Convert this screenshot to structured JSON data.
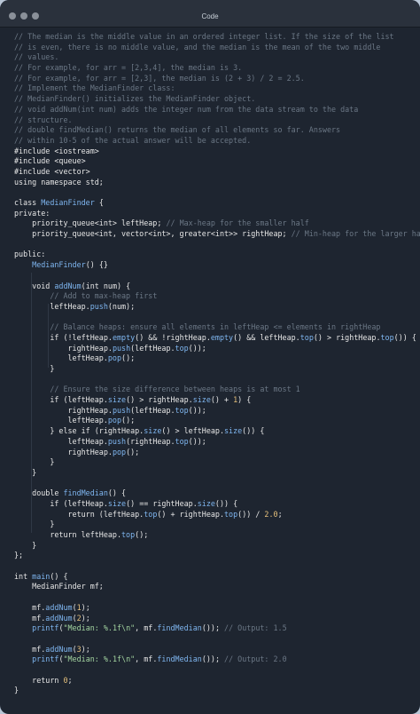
{
  "window": {
    "title": "Code"
  },
  "code_lines": [
    [
      [
        "c",
        "// The median is the middle value in an ordered integer list. If the size of the list"
      ]
    ],
    [
      [
        "c",
        "// is even, there is no middle value, and the median is the mean of the two middle"
      ]
    ],
    [
      [
        "c",
        "// values."
      ]
    ],
    [
      [
        "c",
        "// For example, for arr = [2,3,4], the median is 3."
      ]
    ],
    [
      [
        "c",
        "// For example, for arr = [2,3], the median is (2 + 3) / 2 = 2.5."
      ]
    ],
    [
      [
        "c",
        "// Implement the MedianFinder class:"
      ]
    ],
    [
      [
        "c",
        "// MedianFinder() initializes the MedianFinder object."
      ]
    ],
    [
      [
        "c",
        "// void addNum(int num) adds the integer num from the data stream to the data"
      ]
    ],
    [
      [
        "c",
        "// structure."
      ]
    ],
    [
      [
        "c",
        "// double findMedian() returns the median of all elements so far. Answers"
      ]
    ],
    [
      [
        "c",
        "// within 10-5 of the actual answer will be accepted."
      ]
    ],
    [
      [
        "t",
        "#include <iostream>"
      ]
    ],
    [
      [
        "t",
        "#include <queue>"
      ]
    ],
    [
      [
        "t",
        "#include <vector>"
      ]
    ],
    [
      [
        "t",
        "using namespace std;"
      ]
    ],
    [
      [
        "t",
        ""
      ]
    ],
    [
      [
        "t",
        "class "
      ],
      [
        "f",
        "MedianFinder"
      ],
      [
        "t",
        " {"
      ]
    ],
    [
      [
        "t",
        "private:"
      ]
    ],
    [
      [
        "t",
        "    priority_queue<int> leftHeap; "
      ],
      [
        "c",
        "// Max-heap for the smaller half"
      ]
    ],
    [
      [
        "t",
        "    priority_queue<int, vector<int>, greater<int>> rightHeap; "
      ],
      [
        "c",
        "// Min-heap for the larger half"
      ]
    ],
    [
      [
        "t",
        ""
      ]
    ],
    [
      [
        "t",
        "public:"
      ]
    ],
    [
      [
        "t",
        "    "
      ],
      [
        "f",
        "MedianFinder"
      ],
      [
        "t",
        "() {}"
      ]
    ],
    [
      [
        "t",
        ""
      ]
    ],
    [
      [
        "t",
        "    void "
      ],
      [
        "f",
        "addNum"
      ],
      [
        "t",
        "(int num) {"
      ]
    ],
    [
      [
        "t",
        "        "
      ],
      [
        "c",
        "// Add to max-heap first"
      ]
    ],
    [
      [
        "t",
        "        leftHeap."
      ],
      [
        "f",
        "push"
      ],
      [
        "t",
        "(num);"
      ]
    ],
    [
      [
        "t",
        ""
      ]
    ],
    [
      [
        "t",
        "        "
      ],
      [
        "c",
        "// Balance heaps: ensure all elements in leftHeap <= elements in rightHeap"
      ]
    ],
    [
      [
        "t",
        "        if (!leftHeap."
      ],
      [
        "f",
        "empty"
      ],
      [
        "t",
        "() && !rightHeap."
      ],
      [
        "f",
        "empty"
      ],
      [
        "t",
        "() && leftHeap."
      ],
      [
        "f",
        "top"
      ],
      [
        "t",
        "() > rightHeap."
      ],
      [
        "f",
        "top"
      ],
      [
        "t",
        "()) {"
      ]
    ],
    [
      [
        "t",
        "            rightHeap."
      ],
      [
        "f",
        "push"
      ],
      [
        "t",
        "(leftHeap."
      ],
      [
        "f",
        "top"
      ],
      [
        "t",
        "());"
      ]
    ],
    [
      [
        "t",
        "            leftHeap."
      ],
      [
        "f",
        "pop"
      ],
      [
        "t",
        "();"
      ]
    ],
    [
      [
        "t",
        "        }"
      ]
    ],
    [
      [
        "t",
        ""
      ]
    ],
    [
      [
        "t",
        "        "
      ],
      [
        "c",
        "// Ensure the size difference between heaps is at most 1"
      ]
    ],
    [
      [
        "t",
        "        if (leftHeap."
      ],
      [
        "f",
        "size"
      ],
      [
        "t",
        "() > rightHeap."
      ],
      [
        "f",
        "size"
      ],
      [
        "t",
        "() + "
      ],
      [
        "n",
        "1"
      ],
      [
        "t",
        ") {"
      ]
    ],
    [
      [
        "t",
        "            rightHeap."
      ],
      [
        "f",
        "push"
      ],
      [
        "t",
        "(leftHeap."
      ],
      [
        "f",
        "top"
      ],
      [
        "t",
        "());"
      ]
    ],
    [
      [
        "t",
        "            leftHeap."
      ],
      [
        "f",
        "pop"
      ],
      [
        "t",
        "();"
      ]
    ],
    [
      [
        "t",
        "        } else if (rightHeap."
      ],
      [
        "f",
        "size"
      ],
      [
        "t",
        "() > leftHeap."
      ],
      [
        "f",
        "size"
      ],
      [
        "t",
        "()) {"
      ]
    ],
    [
      [
        "t",
        "            leftHeap."
      ],
      [
        "f",
        "push"
      ],
      [
        "t",
        "(rightHeap."
      ],
      [
        "f",
        "top"
      ],
      [
        "t",
        "());"
      ]
    ],
    [
      [
        "t",
        "            rightHeap."
      ],
      [
        "f",
        "pop"
      ],
      [
        "t",
        "();"
      ]
    ],
    [
      [
        "t",
        "        }"
      ]
    ],
    [
      [
        "t",
        "    }"
      ]
    ],
    [
      [
        "t",
        ""
      ]
    ],
    [
      [
        "t",
        "    double "
      ],
      [
        "f",
        "findMedian"
      ],
      [
        "t",
        "() {"
      ]
    ],
    [
      [
        "t",
        "        if (leftHeap."
      ],
      [
        "f",
        "size"
      ],
      [
        "t",
        "() == rightHeap."
      ],
      [
        "f",
        "size"
      ],
      [
        "t",
        "()) {"
      ]
    ],
    [
      [
        "t",
        "            return (leftHeap."
      ],
      [
        "f",
        "top"
      ],
      [
        "t",
        "() + rightHeap."
      ],
      [
        "f",
        "top"
      ],
      [
        "t",
        "()) / "
      ],
      [
        "n",
        "2.0"
      ],
      [
        "t",
        ";"
      ]
    ],
    [
      [
        "t",
        "        }"
      ]
    ],
    [
      [
        "t",
        "        return leftHeap."
      ],
      [
        "f",
        "top"
      ],
      [
        "t",
        "();"
      ]
    ],
    [
      [
        "t",
        "    }"
      ]
    ],
    [
      [
        "t",
        "};"
      ]
    ],
    [
      [
        "t",
        ""
      ]
    ],
    [
      [
        "t",
        "int "
      ],
      [
        "f",
        "main"
      ],
      [
        "t",
        "() {"
      ]
    ],
    [
      [
        "t",
        "    MedianFinder mf;"
      ]
    ],
    [
      [
        "t",
        ""
      ]
    ],
    [
      [
        "t",
        "    mf."
      ],
      [
        "f",
        "addNum"
      ],
      [
        "t",
        "("
      ],
      [
        "n",
        "1"
      ],
      [
        "t",
        ");"
      ]
    ],
    [
      [
        "t",
        "    mf."
      ],
      [
        "f",
        "addNum"
      ],
      [
        "t",
        "("
      ],
      [
        "n",
        "2"
      ],
      [
        "t",
        ");"
      ]
    ],
    [
      [
        "t",
        "    "
      ],
      [
        "f",
        "printf"
      ],
      [
        "t",
        "("
      ],
      [
        "s",
        "\"Median: %.1f\\n\""
      ],
      [
        "t",
        ", mf."
      ],
      [
        "f",
        "findMedian"
      ],
      [
        "t",
        "()); "
      ],
      [
        "c",
        "// Output: 1.5"
      ]
    ],
    [
      [
        "t",
        ""
      ]
    ],
    [
      [
        "t",
        "    mf."
      ],
      [
        "f",
        "addNum"
      ],
      [
        "t",
        "("
      ],
      [
        "n",
        "3"
      ],
      [
        "t",
        ");"
      ]
    ],
    [
      [
        "t",
        "    "
      ],
      [
        "f",
        "printf"
      ],
      [
        "t",
        "("
      ],
      [
        "s",
        "\"Median: %.1f\\n\""
      ],
      [
        "t",
        ", mf."
      ],
      [
        "f",
        "findMedian"
      ],
      [
        "t",
        "()); "
      ],
      [
        "c",
        "// Output: 2.0"
      ]
    ],
    [
      [
        "t",
        ""
      ]
    ],
    [
      [
        "t",
        "    return "
      ],
      [
        "n",
        "0"
      ],
      [
        "t",
        ";"
      ]
    ],
    [
      [
        "t",
        "}"
      ]
    ]
  ],
  "colors": {
    "background": "#1e2530",
    "titlebar": "#2a313c",
    "comment": "#6b7785",
    "text": "#e6e6e6",
    "function": "#7fb6f0",
    "string": "#a3d4a0",
    "number": "#e6c07b"
  }
}
